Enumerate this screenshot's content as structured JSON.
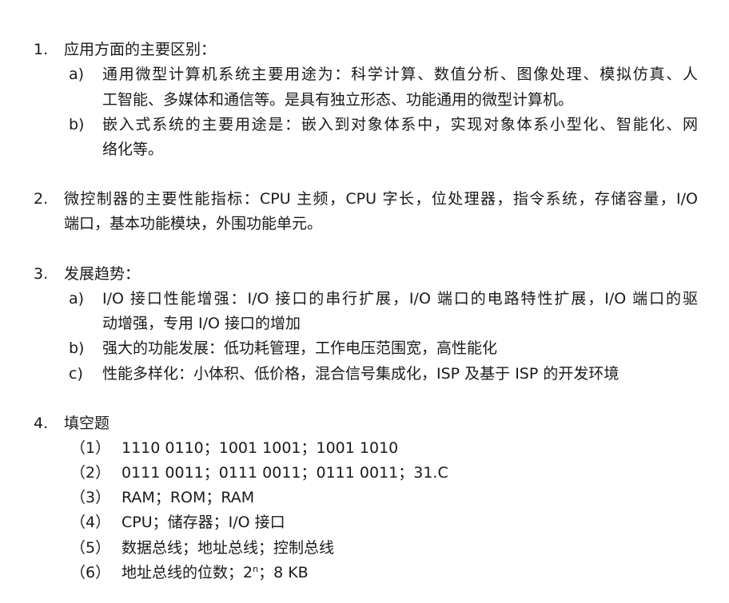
{
  "sections": [
    {
      "number": "1.",
      "title": "应用方面的主要区别：",
      "items": [
        {
          "marker": "a)",
          "lines": [
            "通用微型计算机系统主要用途为：科学计算、数值分析、图像处理、模拟仿真、人",
            "工智能、多媒体和通信等。是具有独立形态、功能通用的微型计算机。"
          ]
        },
        {
          "marker": "b)",
          "lines": [
            "嵌入式系统的主要用途是：嵌入到对象体系中，实现对象体系小型化、智能化、网",
            "络化等。"
          ]
        }
      ]
    },
    {
      "number": "2.",
      "lines": [
        "微控制器的主要性能指标：CPU 主频，CPU 字长，位处理器，指令系统，存储容量，I/O",
        "端口，基本功能模块，外围功能单元。"
      ]
    },
    {
      "number": "3.",
      "title": "发展趋势：",
      "items": [
        {
          "marker": "a)",
          "lines": [
            "I/O 接口性能增强：I/O 接口的串行扩展，I/O 端口的电路特性扩展，I/O 端口的驱",
            "动增强，专用 I/O 接口的增加"
          ]
        },
        {
          "marker": "b)",
          "lines": [
            "强大的功能发展：低功耗管理，工作电压范围宽，高性能化"
          ]
        },
        {
          "marker": "c)",
          "lines": [
            "性能多样化：小体积、低价格，混合信号集成化，ISP 及基于 ISP 的开发环境"
          ]
        }
      ]
    },
    {
      "number": "4.",
      "title": "填空题",
      "answers": [
        {
          "marker": "（1）",
          "text": "1110 0110；1001 1001；1001 1010"
        },
        {
          "marker": "（2）",
          "text": "0111 0011；0111 0011；0111 0011；31.C"
        },
        {
          "marker": "（3）",
          "text": "RAM；ROM；RAM"
        },
        {
          "marker": "（4）",
          "text": "CPU；储存器；I/O 接口"
        },
        {
          "marker": "（5）",
          "text": "数据总线；地址总线；控制总线"
        },
        {
          "marker": "（6）",
          "text_before": "地址总线的位数；2",
          "superscript": "n",
          "text_after": "；8 KB"
        }
      ]
    }
  ]
}
